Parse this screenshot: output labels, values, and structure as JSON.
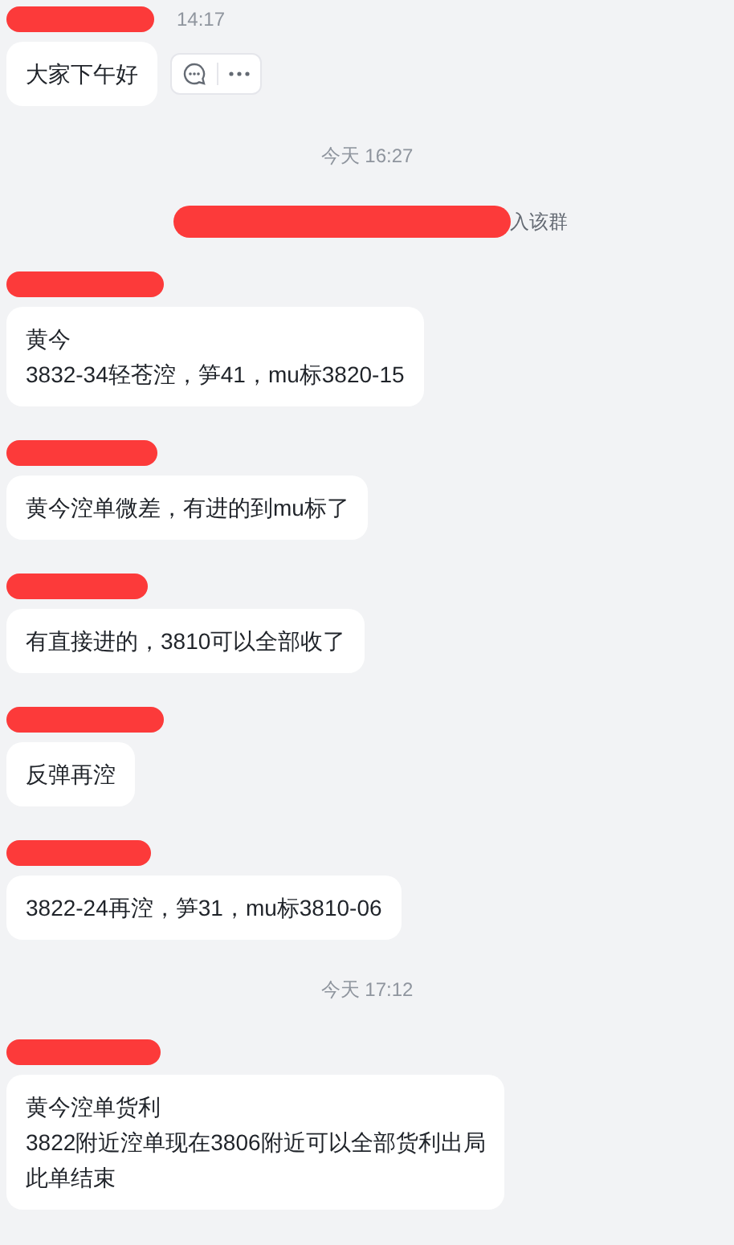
{
  "items": [
    {
      "kind": "message",
      "time": "14:17",
      "lines": [
        "大家下午好"
      ],
      "actions": true
    },
    {
      "kind": "time",
      "text": "今天 16:27"
    },
    {
      "kind": "notice",
      "text": "入该群"
    },
    {
      "kind": "message",
      "lines": [
        "黄今",
        "3832-34轻苍涳，笋41，mu标3820-15"
      ]
    },
    {
      "kind": "message",
      "lines": [
        "黄今涳单微差，有进的到mu标了"
      ]
    },
    {
      "kind": "message",
      "lines": [
        "有直接进的，3810可以全部收了"
      ]
    },
    {
      "kind": "message",
      "lines": [
        "反弹再涳"
      ]
    },
    {
      "kind": "message",
      "lines": [
        "3822-24再涳，笋31，mu标3810-06"
      ]
    },
    {
      "kind": "time",
      "text": "今天 17:12"
    },
    {
      "kind": "message",
      "lines": [
        "黄今涳单货利",
        "3822附近涳单现在3806附近可以全部货利出局",
        "此单结束"
      ]
    }
  ]
}
